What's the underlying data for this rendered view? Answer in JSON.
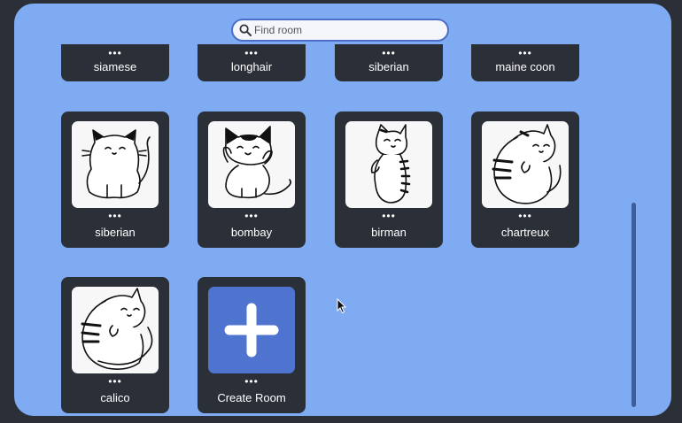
{
  "search": {
    "placeholder": "Find room",
    "icon": "search-icon"
  },
  "rows": {
    "top": [
      {
        "name": "siamese",
        "menu": "•••"
      },
      {
        "name": "longhair",
        "menu": "•••"
      },
      {
        "name": "siberian",
        "menu": "•••"
      },
      {
        "name": "maine coon",
        "menu": "•••"
      }
    ],
    "middle": [
      {
        "name": "siberian",
        "menu": "•••"
      },
      {
        "name": "bombay",
        "menu": "•••"
      },
      {
        "name": "birman",
        "menu": "•••"
      },
      {
        "name": "chartreux",
        "menu": "•••"
      }
    ],
    "bottom": [
      {
        "name": "calico",
        "menu": "•••"
      },
      {
        "name": "Create Room",
        "menu": "•••",
        "icon": "plus-icon"
      }
    ]
  },
  "colors": {
    "background": "#7eabf2",
    "card": "#2b2f38",
    "accent": "#4f74d0"
  }
}
